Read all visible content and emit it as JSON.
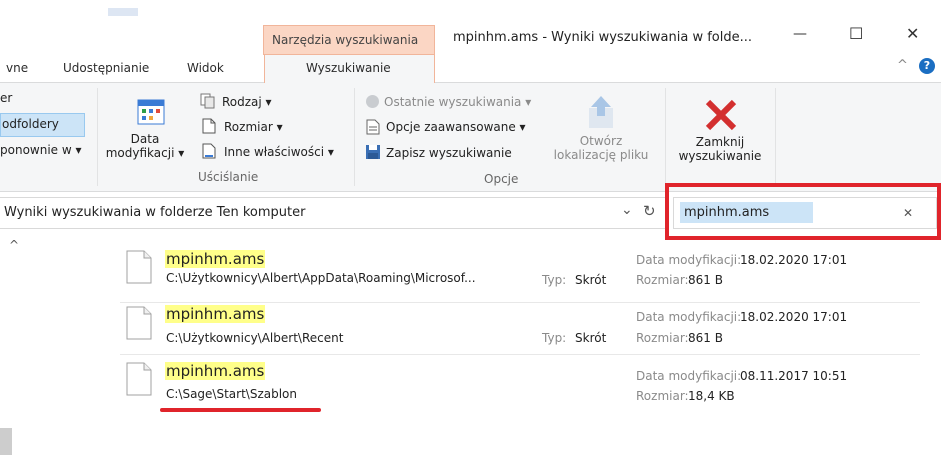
{
  "window": {
    "context_tab": "Narzędzia wyszukiwania",
    "title": "mpinhm.ams - Wyniki wyszukiwania w folde...",
    "controls": {
      "minimize": "—",
      "maximize": "☐",
      "close": "✕"
    },
    "help_chevron": "^",
    "help_q": "?"
  },
  "tabs": [
    "vne",
    "Udostępnianie",
    "Widok",
    "Wyszukiwanie"
  ],
  "ribbon": {
    "left_partial": [
      "er",
      "odfoldery",
      "ponownie w ▾"
    ],
    "date_button": {
      "line1": "Data",
      "line2": "modyfikacji ▾"
    },
    "refine_items": [
      "Rodzaj ▾",
      "Rozmiar ▾",
      "Inne właściwości ▾"
    ],
    "refine_group": "Uściślanie",
    "options_items": [
      "Ostatnie wyszukiwania ▾",
      "Opcje zaawansowane ▾",
      "Zapisz wyszukiwanie"
    ],
    "open_location": {
      "line1": "Otwórz",
      "line2": "lokalizację pliku"
    },
    "options_group": "Opcje",
    "close_search": {
      "line1": "Zamknij",
      "line2": "wyszukiwanie"
    }
  },
  "address_bar": {
    "path": "Wyniki wyszukiwania w folderze Ten komputer",
    "dropdown": "⌄",
    "refresh": "↻"
  },
  "search": {
    "value": "mpinhm.ams",
    "clear": "✕"
  },
  "scroll_up": "^",
  "results": [
    {
      "name": "mpinhm.ams",
      "path": "C:\\Użytkownicy\\Albert\\AppData\\Roaming\\Microsof...",
      "type_label": "Typ:",
      "type_value": "Skrót",
      "date_label": "Data modyfikacji:",
      "date_value": "18.02.2020 17:01",
      "size_label": "Rozmiar:",
      "size_value": "861 B"
    },
    {
      "name": "mpinhm.ams",
      "path": "C:\\Użytkownicy\\Albert\\Recent",
      "type_label": "Typ:",
      "type_value": "Skrót",
      "date_label": "Data modyfikacji:",
      "date_value": "18.02.2020 17:01",
      "size_label": "Rozmiar:",
      "size_value": "861 B"
    },
    {
      "name": "mpinhm.ams",
      "path": "C:\\Sage\\Start\\Szablon",
      "type_label": "",
      "type_value": "",
      "date_label": "Data modyfikacji:",
      "date_value": "08.11.2017 10:51",
      "size_label": "Rozmiar:",
      "size_value": "18,4 KB"
    }
  ],
  "colors": {
    "context_tab_bg": "#fbd6c4",
    "highlight": "#ffff8a",
    "annotation_red": "#e0242b",
    "close_x_red": "#d32f2f",
    "search_select": "#cce4f7"
  }
}
